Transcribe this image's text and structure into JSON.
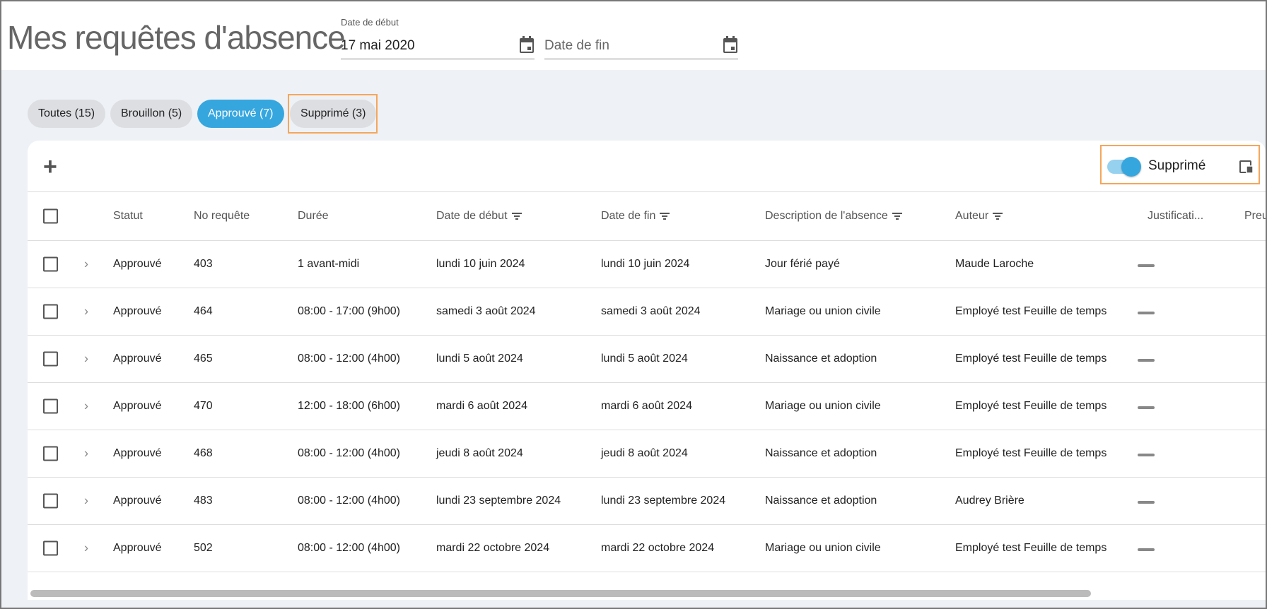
{
  "header": {
    "title": "Mes requêtes d'absence",
    "start_date": {
      "label": "Date de début",
      "value": "17 mai 2020"
    },
    "end_date": {
      "placeholder": "Date de fin"
    }
  },
  "filters": [
    {
      "label": "Toutes (15)"
    },
    {
      "label": "Brouillon (5)"
    },
    {
      "label": "Approuvé (7)",
      "active": true
    },
    {
      "label": "Supprimé (3)"
    }
  ],
  "toolbar": {
    "add": "+",
    "toggle_label": "Supprimé",
    "toggle_on": true
  },
  "columns": [
    "Statut",
    "No requête",
    "Durée",
    "Date de début",
    "Date de fin",
    "Description de l'absence",
    "Auteur",
    "Justificati...",
    "Preu"
  ],
  "rows": [
    [
      "Approuvé",
      "403",
      "1 avant-midi",
      "lundi 10 juin 2024",
      "lundi 10 juin 2024",
      "Jour férié payé",
      "Maude Laroche"
    ],
    [
      "Approuvé",
      "464",
      "08:00 - 17:00 (9h00)",
      "samedi 3 août 2024",
      "samedi 3 août 2024",
      "Mariage ou union civile",
      "Employé test Feuille de temps"
    ],
    [
      "Approuvé",
      "465",
      "08:00 - 12:00 (4h00)",
      "lundi 5 août 2024",
      "lundi 5 août 2024",
      "Naissance et adoption",
      "Employé test Feuille de temps"
    ],
    [
      "Approuvé",
      "470",
      "12:00 - 18:00 (6h00)",
      "mardi 6 août 2024",
      "mardi 6 août 2024",
      "Mariage ou union civile",
      "Employé test Feuille de temps"
    ],
    [
      "Approuvé",
      "468",
      "08:00 - 12:00 (4h00)",
      "jeudi 8 août 2024",
      "jeudi 8 août 2024",
      "Naissance et adoption",
      "Employé test Feuille de temps"
    ],
    [
      "Approuvé",
      "483",
      "08:00 - 12:00 (4h00)",
      "lundi 23 septembre 2024",
      "lundi 23 septembre 2024",
      "Naissance et adoption",
      "Audrey Brière"
    ],
    [
      "Approuvé",
      "502",
      "08:00 - 12:00 (4h00)",
      "mardi 22 octobre 2024",
      "mardi 22 octobre 2024",
      "Mariage ou union civile",
      "Employé test Feuille de temps"
    ]
  ],
  "colors": {
    "accent": "#36a6df",
    "highlight": "#f5a65b"
  }
}
